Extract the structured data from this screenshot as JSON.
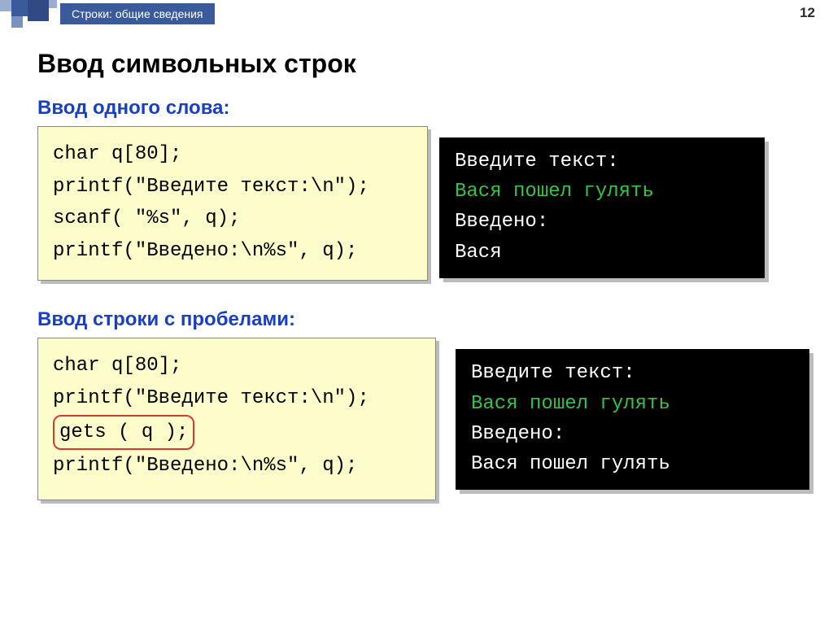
{
  "page_number": "12",
  "crumb": "Строки: общие сведения",
  "title": "Ввод символьных строк",
  "section1": {
    "heading": "Ввод одного слова:",
    "code": {
      "l1": "char q[80];",
      "l2": "printf(\"Введите текст:\\n\");",
      "l3": "scanf( \"%s\", q);",
      "l4": "printf(\"Введено:\\n%s\", q);"
    },
    "term": {
      "l1": "Введите текст:",
      "l2": "Вася пошел гулять",
      "l3": "Введено:",
      "l4": "Вася"
    }
  },
  "section2": {
    "heading": "Ввод строки с пробелами:",
    "code": {
      "l1": "char q[80];",
      "l2": "printf(\"Введите текст:\\n\");",
      "l3": "gets ( q );",
      "l4": "printf(\"Введено:\\n%s\", q);"
    },
    "term": {
      "l1": "Введите текст:",
      "l2": "Вася пошел гулять",
      "l3": "Введено:",
      "l4": "Вася пошел гулять"
    }
  }
}
